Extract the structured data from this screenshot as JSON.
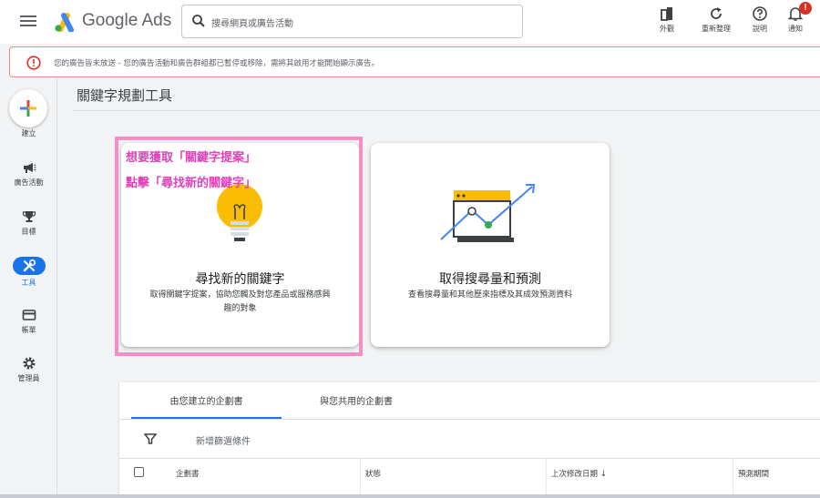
{
  "header": {
    "brand": "Google Ads",
    "search_placeholder": "搜尋網頁或廣告活動",
    "tools": [
      {
        "label": "外觀",
        "icon": "appearance-icon"
      },
      {
        "label": "重新整理",
        "icon": "refresh-icon"
      },
      {
        "label": "說明",
        "icon": "help-icon"
      },
      {
        "label": "通知",
        "icon": "bell-icon",
        "badge": "!"
      }
    ]
  },
  "alert": {
    "message": "您的廣告皆未放送 - 您的廣告活動和廣告群組都已暫停或移除，需將其啟用才能開始顯示廣告。"
  },
  "sidebar": {
    "create_label": "建立",
    "items": [
      {
        "label": "廣告活動",
        "icon": "megaphone-icon"
      },
      {
        "label": "目標",
        "icon": "trophy-icon"
      },
      {
        "label": "工具",
        "icon": "tools-icon",
        "active": true
      },
      {
        "label": "帳單",
        "icon": "credit-card-icon"
      },
      {
        "label": "管理員",
        "icon": "gear-icon"
      }
    ]
  },
  "page": {
    "title": "關鍵字規劃工具"
  },
  "cards": [
    {
      "title": "尋找新的關鍵字",
      "description": "取得關鍵字提案，協助您觸及對您產品或服務感興趣的對象",
      "icon": "lightbulb-icon"
    },
    {
      "title": "取得搜尋量和預測",
      "description": "查看搜尋量和其他歷來指標及其成效預測資料",
      "icon": "trend-chart-icon"
    }
  ],
  "annotation": {
    "line1": "想要獲取「關鍵字提案」",
    "line2": "點擊「尋找新的關鍵字」"
  },
  "plans": {
    "tabs": [
      "由您建立的企劃書",
      "與您共用的企劃書"
    ],
    "filter_label": "新增篩選條件",
    "columns": [
      "企劃書",
      "狀態",
      "上次修改日期 ↓",
      "預測期間"
    ]
  },
  "colors": {
    "accent": "#1a73e8",
    "alert_border": "#f28b82",
    "alert_icon": "#d93025",
    "highlight": "#f48fc6",
    "annotation_text": "#e040b8"
  }
}
